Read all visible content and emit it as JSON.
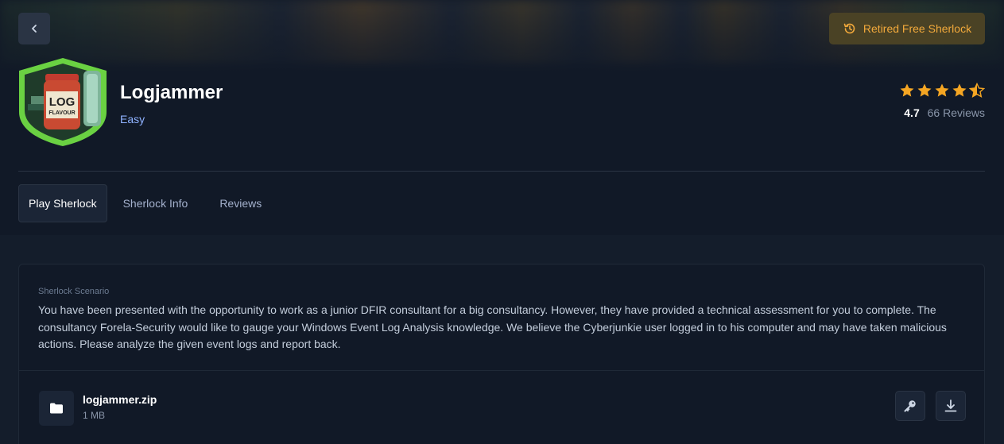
{
  "header": {
    "back_icon": "chevron-left-icon",
    "status_button": {
      "label": "Retired Free Sherlock",
      "icon": "history-icon",
      "color": "#f2a93b"
    }
  },
  "sherlock": {
    "badge_text_top": "LOG",
    "badge_text_bottom": "FLAVOUR",
    "title": "Logjammer",
    "difficulty": "Easy",
    "rating": {
      "value": "4.7",
      "reviews": "66 Reviews",
      "stars_filled": 4.5,
      "stars_total": 5,
      "star_color": "#f5a623"
    }
  },
  "tabs": [
    {
      "label": "Play Sherlock",
      "active": true
    },
    {
      "label": "Sherlock Info",
      "active": false
    },
    {
      "label": "Reviews",
      "active": false
    }
  ],
  "scenario": {
    "label": "Sherlock Scenario",
    "text": "You have been presented with the opportunity to work as a junior DFIR consultant for a big consultancy. However, they have provided a technical assessment for you to complete. The consultancy Forela-Security would like to gauge your Windows Event Log Analysis knowledge. We believe the Cyberjunkie user logged in to his computer and may have taken malicious actions. Please analyze the given event logs and report back."
  },
  "file": {
    "name": "logjammer.zip",
    "size": "1 MB",
    "icon": "folder-icon",
    "actions": [
      {
        "icon": "key-icon"
      },
      {
        "icon": "download-icon"
      }
    ]
  },
  "colors": {
    "background": "#141d2b",
    "link": "#8fb2ff",
    "badge_green": "#6ad142"
  }
}
